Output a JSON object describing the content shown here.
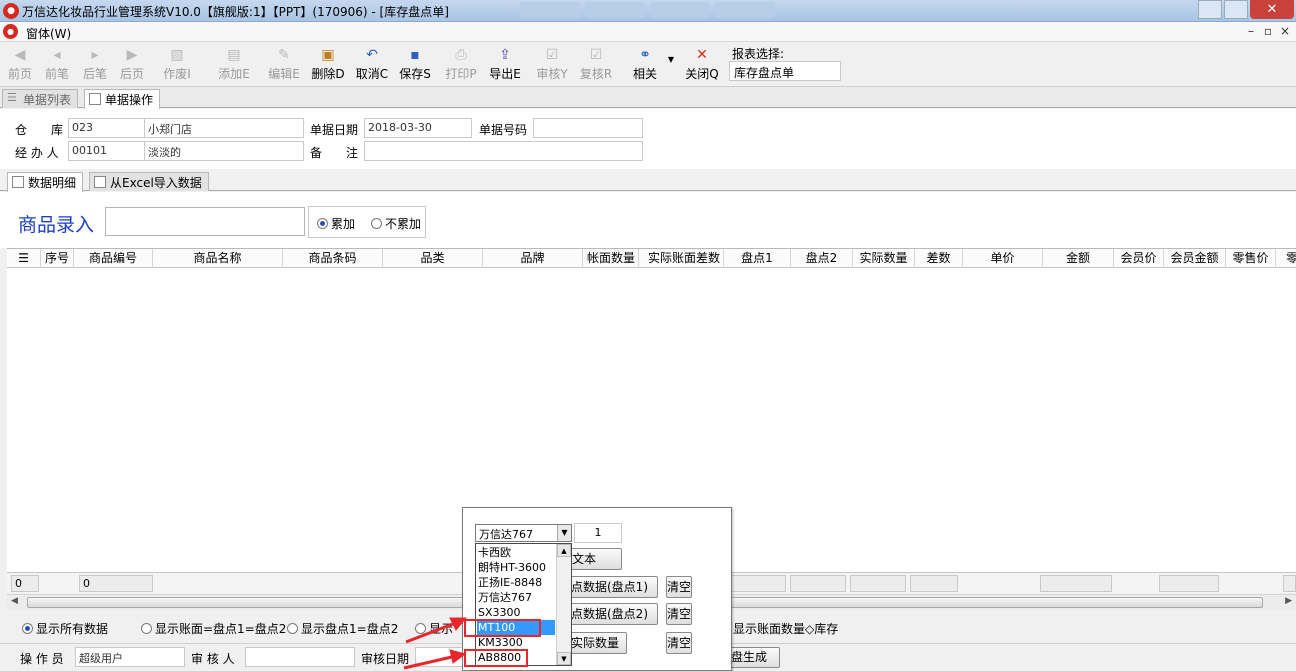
{
  "window": {
    "title": "万信达化妆品行业管理系统V10.0【旗舰版:1】【PPT】(170906) - [库存盘点单]",
    "close_glyph": "✕"
  },
  "menu": {
    "item": "窗体(W)"
  },
  "toolbar": {
    "buttons": [
      {
        "label": "前页",
        "icon": "arrow-first-icon",
        "enabled": false
      },
      {
        "label": "前笔",
        "icon": "arrow-prev-icon",
        "enabled": false
      },
      {
        "label": "后笔",
        "icon": "arrow-next-icon",
        "enabled": false
      },
      {
        "label": "后页",
        "icon": "arrow-last-icon",
        "enabled": false
      },
      {
        "label": "作废I",
        "icon": "void-icon",
        "enabled": false
      },
      {
        "label": "添加E",
        "icon": "add-icon",
        "enabled": false
      },
      {
        "label": "编辑E",
        "icon": "edit-icon",
        "enabled": false
      },
      {
        "label": "删除D",
        "icon": "delete-icon",
        "enabled": true
      },
      {
        "label": "取消C",
        "icon": "undo-icon",
        "enabled": true
      },
      {
        "label": "保存S",
        "icon": "save-icon",
        "enabled": true
      },
      {
        "label": "打印P",
        "icon": "print-icon",
        "enabled": false
      },
      {
        "label": "导出E",
        "icon": "export-icon",
        "enabled": true
      },
      {
        "label": "审核Y",
        "icon": "approve-icon",
        "enabled": false
      },
      {
        "label": "复核R",
        "icon": "recheck-icon",
        "enabled": false
      },
      {
        "label": "相关",
        "icon": "link-icon",
        "enabled": true
      },
      {
        "label": "关闭Q",
        "icon": "close-icon",
        "enabled": true
      }
    ],
    "report_label": "报表选择:",
    "report_value": "库存盘点单"
  },
  "tabs": {
    "list": "单据列表",
    "ops": "单据操作"
  },
  "form": {
    "warehouse_label": "仓　　库",
    "warehouse_code": "023",
    "warehouse_name": "小郑门店",
    "date_label": "单据日期",
    "date_value": "2018-03-30",
    "docno_label": "单据号码",
    "docno_value": "",
    "handler_label": "经 办 人",
    "handler_code": "00101",
    "handler_name": "淡淡的",
    "remark_label": "备　　注",
    "remark_value": ""
  },
  "subtabs": {
    "detail": "数据明细",
    "excel": "从Excel导入数据"
  },
  "entry": {
    "label": "商品录入",
    "value": "",
    "radio_accum": "累加",
    "radio_noaccum": "不累加"
  },
  "grid": {
    "columns": [
      "序号",
      "商品编号",
      "商品名称",
      "商品条码",
      "品类",
      "品牌",
      "帐面数量",
      "实际账面差数",
      "盘点1",
      "盘点2",
      "实际数量",
      "差数",
      "单价",
      "金额",
      "会员价",
      "会员金额",
      "零售价",
      "零"
    ],
    "footer_cells": [
      "0",
      "0"
    ]
  },
  "options": {
    "opt1": "显示所有数据",
    "opt2": "显示账面=盘点1=盘点2",
    "opt3": "显示盘点1=盘点2",
    "opt4_partial": "显示",
    "opt5_partial": "显示账面数量◇库存"
  },
  "bottom": {
    "operator_label": "操 作 员",
    "operator_value": "超级用户",
    "reviewer_label": "审 核 人",
    "reviewer_value": "",
    "review_date_label": "审核日期",
    "gen_btn": "盘生成"
  },
  "popup": {
    "combo_value": "万信达767",
    "count_value": "1",
    "btn_text": "文本",
    "btn_p1": "点数据(盘点1)",
    "btn_p2": "点数据(盘点2)",
    "btn_actual": "实际数量",
    "clear": "清空",
    "dropdown_items": [
      "卡西欧",
      "朗特HT-3600",
      "正扬IE-8848",
      "万信达767",
      "SX3300",
      "MT100",
      "KM3300",
      "AB8800"
    ],
    "selected_item": "MT100"
  },
  "colors": {
    "accent_blue": "#1a3ec2",
    "selection": "#3399ff",
    "highlight_red": "#e8262b",
    "close_red": "#c8413a"
  }
}
